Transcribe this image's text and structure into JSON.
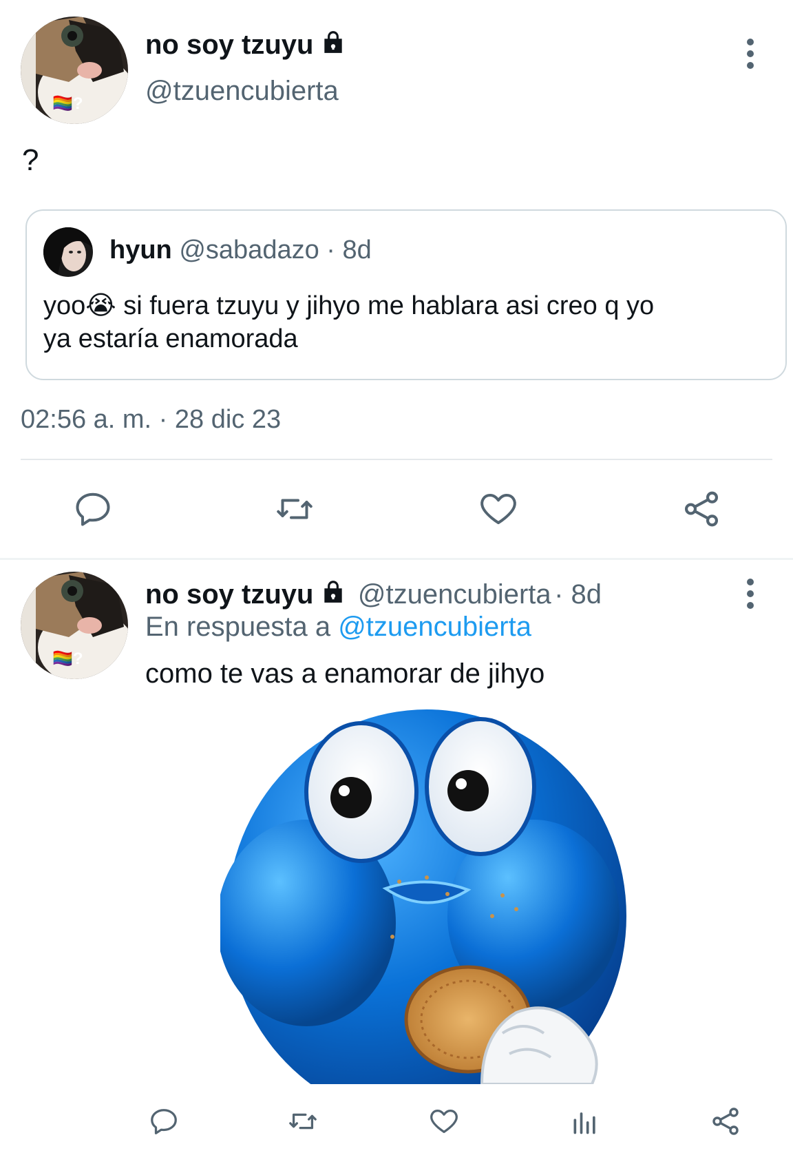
{
  "tweet": {
    "author_name": "no soy tzuyu",
    "author_handle": "@tzuencubierta",
    "text": "?",
    "timestamp": "02:56 a. m. · 28 dic 23",
    "quoted": {
      "author_name": "hyun",
      "author_handle": "@sabadazo",
      "age": "· 8d",
      "text_line1": "yoo😭 si fuera tzuyu y jihyo me hablara asi creo q yo",
      "text_line2": "ya estaría enamorada"
    }
  },
  "reply": {
    "author_name": "no soy tzuyu",
    "author_handle": "@tzuencubierta",
    "age": "· 8d",
    "in_reply_prefix": "En respuesta a",
    "in_reply_handle": "@tzuencubierta",
    "text": "como te vas a enamorar de jihyo"
  },
  "avatar_badge": "🏳️‍🌈?",
  "icons": {
    "reply": "reply-icon",
    "retweet": "retweet-icon",
    "like": "heart-icon",
    "share": "share-icon",
    "views": "views-icon",
    "more": "more-vertical-icon",
    "lock": "lock-icon"
  },
  "colors": {
    "text_primary": "#0f1419",
    "text_secondary": "#536471",
    "link": "#1d9bf0",
    "border": "#cfd9de"
  }
}
